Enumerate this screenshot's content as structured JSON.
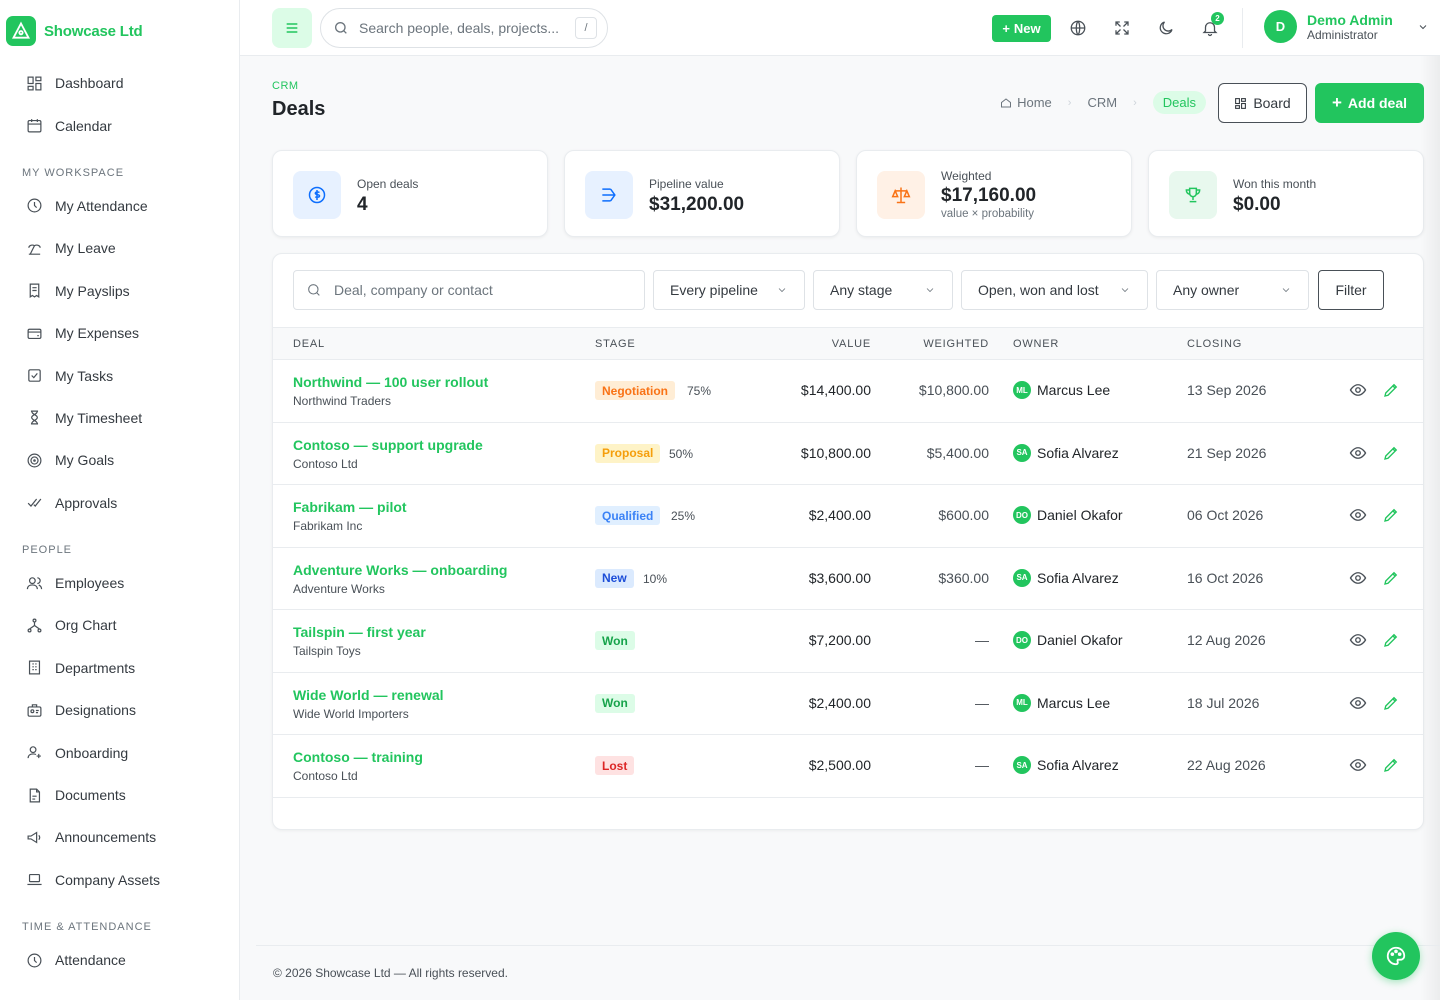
{
  "brand": {
    "name": "Showcase Ltd"
  },
  "sidebar": {
    "top_items": [
      {
        "label": "Dashboard",
        "icon": "dashboard-icon"
      },
      {
        "label": "Calendar",
        "icon": "calendar-icon"
      }
    ],
    "sections": [
      {
        "title": "MY WORKSPACE",
        "items": [
          {
            "label": "My Attendance",
            "icon": "clock-icon"
          },
          {
            "label": "My Leave",
            "icon": "beach-icon"
          },
          {
            "label": "My Payslips",
            "icon": "receipt-icon"
          },
          {
            "label": "My Expenses",
            "icon": "wallet-icon"
          },
          {
            "label": "My Tasks",
            "icon": "checkbox-icon"
          },
          {
            "label": "My Timesheet",
            "icon": "hourglass-icon"
          },
          {
            "label": "My Goals",
            "icon": "target-icon"
          },
          {
            "label": "Approvals",
            "icon": "checks-icon"
          }
        ]
      },
      {
        "title": "PEOPLE",
        "items": [
          {
            "label": "Employees",
            "icon": "users-icon"
          },
          {
            "label": "Org Chart",
            "icon": "hierarchy-icon"
          },
          {
            "label": "Departments",
            "icon": "building-icon"
          },
          {
            "label": "Designations",
            "icon": "badge-icon"
          },
          {
            "label": "Onboarding",
            "icon": "user-plus-icon"
          },
          {
            "label": "Documents",
            "icon": "document-icon"
          },
          {
            "label": "Announcements",
            "icon": "megaphone-icon"
          },
          {
            "label": "Company Assets",
            "icon": "laptop-icon"
          }
        ]
      },
      {
        "title": "TIME & ATTENDANCE",
        "items": [
          {
            "label": "Attendance",
            "icon": "clock-icon"
          }
        ]
      }
    ]
  },
  "topbar": {
    "search_placeholder": "Search people, deals, projects...",
    "search_shortcut": "/",
    "new_label": "New",
    "notification_count": "2",
    "user_name": "Demo Admin",
    "user_role": "Administrator",
    "user_initial": "D"
  },
  "header": {
    "eyebrow": "CRM",
    "title": "Deals",
    "breadcrumb": [
      "Home",
      "CRM",
      "Deals"
    ],
    "board_label": "Board",
    "add_label": "Add deal"
  },
  "stats": [
    {
      "label": "Open deals",
      "value": "4",
      "sub": "",
      "icon": "dollar-icon",
      "color": "#0d6efd",
      "bg": "#e7f1ff"
    },
    {
      "label": "Pipeline value",
      "value": "$31,200.00",
      "sub": "",
      "icon": "pipeline-icon",
      "color": "#0d6efd",
      "bg": "#e7f1ff"
    },
    {
      "label": "Weighted",
      "value": "$17,160.00",
      "sub": "value × probability",
      "icon": "scale-icon",
      "color": "#f97316",
      "bg": "#fff1e6"
    },
    {
      "label": "Won this month",
      "value": "$0.00",
      "sub": "",
      "icon": "trophy-icon",
      "color": "#22c55e",
      "bg": "#e8f8ee"
    }
  ],
  "filters": {
    "search_placeholder": "Deal, company or contact",
    "pipeline": "Every pipeline",
    "stage": "Any stage",
    "status": "Open, won and lost",
    "owner": "Any owner",
    "filter_label": "Filter"
  },
  "table": {
    "headers": {
      "deal": "DEAL",
      "stage": "STAGE",
      "value": "VALUE",
      "weighted": "WEIGHTED",
      "owner": "OWNER",
      "closing": "CLOSING"
    },
    "rows": [
      {
        "name": "Northwind — 100 user rollout",
        "company": "Northwind Traders",
        "stage": "Negotiation",
        "pct": "75%",
        "value": "$14,400.00",
        "weighted": "$10,800.00",
        "owner": "Marcus Lee",
        "initials": "ML",
        "closing": "13 Sep 2026"
      },
      {
        "name": "Contoso — support upgrade",
        "company": "Contoso Ltd",
        "stage": "Proposal",
        "pct": "50%",
        "value": "$10,800.00",
        "weighted": "$5,400.00",
        "owner": "Sofia Alvarez",
        "initials": "SA",
        "closing": "21 Sep 2026"
      },
      {
        "name": "Fabrikam — pilot",
        "company": "Fabrikam Inc",
        "stage": "Qualified",
        "pct": "25%",
        "value": "$2,400.00",
        "weighted": "$600.00",
        "owner": "Daniel Okafor",
        "initials": "DO",
        "closing": "06 Oct 2026"
      },
      {
        "name": "Adventure Works — onboarding",
        "company": "Adventure Works",
        "stage": "New",
        "pct": "10%",
        "value": "$3,600.00",
        "weighted": "$360.00",
        "owner": "Sofia Alvarez",
        "initials": "SA",
        "closing": "16 Oct 2026"
      },
      {
        "name": "Tailspin — first year",
        "company": "Tailspin Toys",
        "stage": "Won",
        "pct": "",
        "value": "$7,200.00",
        "weighted": "—",
        "owner": "Daniel Okafor",
        "initials": "DO",
        "closing": "12 Aug 2026"
      },
      {
        "name": "Wide World — renewal",
        "company": "Wide World Importers",
        "stage": "Won",
        "pct": "",
        "value": "$2,400.00",
        "weighted": "—",
        "owner": "Marcus Lee",
        "initials": "ML",
        "closing": "18 Jul 2026"
      },
      {
        "name": "Contoso — training",
        "company": "Contoso Ltd",
        "stage": "Lost",
        "pct": "",
        "value": "$2,500.00",
        "weighted": "—",
        "owner": "Sofia Alvarez",
        "initials": "SA",
        "closing": "22 Aug 2026"
      }
    ]
  },
  "stage_colors": {
    "Negotiation": {
      "fg": "#f97316",
      "bg": "#ffedd5"
    },
    "Proposal": {
      "fg": "#f59e0b",
      "bg": "#fef3c7"
    },
    "Qualified": {
      "fg": "#3b82f6",
      "bg": "#e0efff"
    },
    "New": {
      "fg": "#1d4ed8",
      "bg": "#dbeafe"
    },
    "Won": {
      "fg": "#16a34a",
      "bg": "#dcfce7"
    },
    "Lost": {
      "fg": "#dc2626",
      "bg": "#fee2e2"
    }
  },
  "footer": {
    "text": "© 2026 Showcase Ltd — All rights reserved."
  }
}
